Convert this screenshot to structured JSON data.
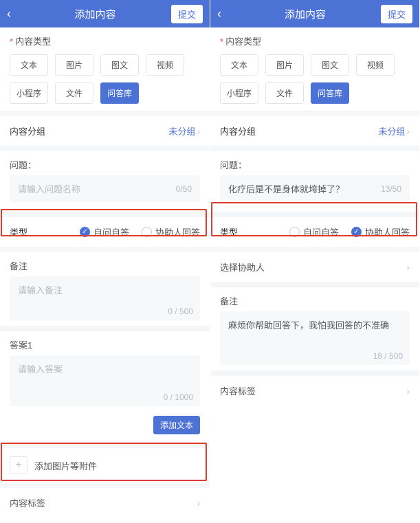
{
  "header": {
    "title": "添加内容",
    "submit": "提交"
  },
  "types": {
    "label": "内容类型",
    "items": [
      "文本",
      "图片",
      "图文",
      "视频",
      "小程序",
      "文件",
      "问答库"
    ],
    "active_index": 6
  },
  "group": {
    "label": "内容分组",
    "value": "未分组"
  },
  "question": {
    "label": "问题：",
    "placeholder": "请输入问题名称",
    "max": 50
  },
  "type_radio": {
    "label": "类型",
    "opt1": "自问自答",
    "opt2": "协助人回答"
  },
  "remark": {
    "label": "备注",
    "placeholder": "请输入备注",
    "max": 500
  },
  "answer": {
    "label": "答案1",
    "placeholder": "请输入答案",
    "max": 1000,
    "count": "0 / 1000"
  },
  "add_text_btn": "添加文本",
  "attach": {
    "label": "添加图片等附件"
  },
  "tags": {
    "label": "内容标签"
  },
  "left": {
    "question_value": "",
    "question_count": "0/50",
    "remark_value": "",
    "remark_count": "0 / 500",
    "radio_selected": 0
  },
  "right": {
    "question_value": "化疗后是不是身体就垮掉了？",
    "question_count": "13/50",
    "remark_value": "麻烦你帮助回答下，我怕我回答的不准确",
    "remark_count": "18 / 500",
    "helper_label": "选择协助人",
    "radio_selected": 1
  }
}
